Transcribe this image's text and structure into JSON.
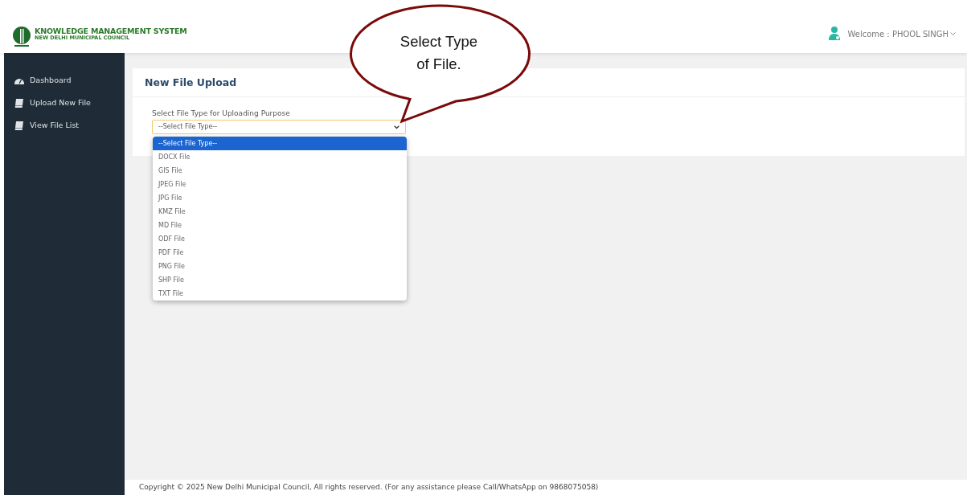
{
  "header": {
    "logo_title": "KNOWLEDGE MANAGEMENT SYSTEM",
    "logo_subtitle": "NEW DELHI MUNICIPAL COUNCIL",
    "user_menu": "Welcome : PHOOL SINGH"
  },
  "sidebar": {
    "items": [
      {
        "label": "Dashboard",
        "kind": "dashboard"
      },
      {
        "label": "Upload New File",
        "kind": "book"
      },
      {
        "label": "View File List",
        "kind": "book"
      }
    ]
  },
  "card": {
    "title": "New File Upload",
    "field_label": "Select File Type for Uploading Purpose",
    "select_value": "--Select File Type--",
    "options": [
      {
        "label": "--Select File Type--",
        "selected": true
      },
      {
        "label": "DOCX File",
        "selected": false
      },
      {
        "label": "GIS File",
        "selected": false
      },
      {
        "label": "JPEG File",
        "selected": false
      },
      {
        "label": "JPG File",
        "selected": false
      },
      {
        "label": "KMZ File",
        "selected": false
      },
      {
        "label": "MD File",
        "selected": false
      },
      {
        "label": "ODF File",
        "selected": false
      },
      {
        "label": "PDF File",
        "selected": false
      },
      {
        "label": "PNG File",
        "selected": false
      },
      {
        "label": "SHP File",
        "selected": false
      },
      {
        "label": "TXT File",
        "selected": false
      }
    ]
  },
  "callout": {
    "lines": [
      "Select Type",
      "of File."
    ]
  },
  "footer": "Copyright © 2025 New Delhi Municipal Council, All rights reserved. (For any assistance please Call/WhatsApp on 9868075058)"
}
